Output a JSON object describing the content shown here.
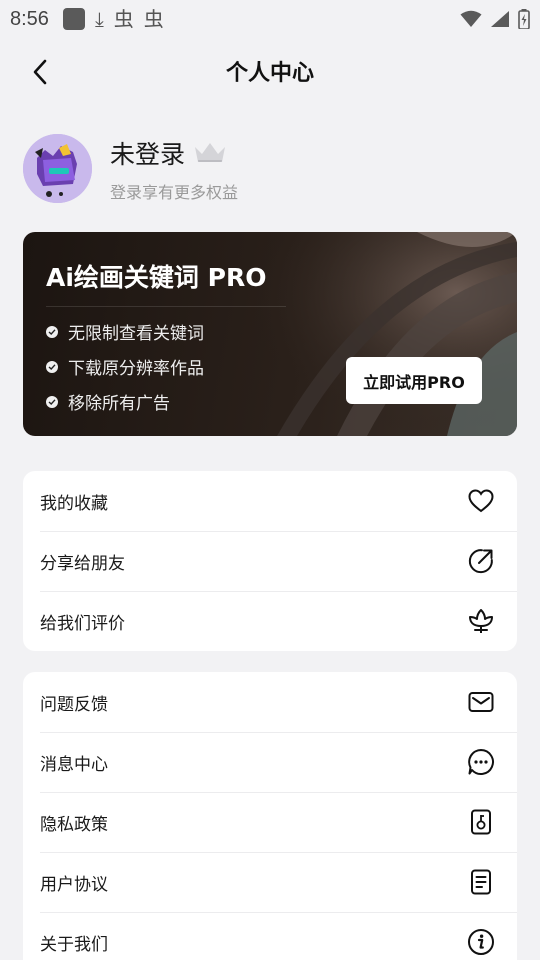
{
  "status_bar": {
    "time": "8:56",
    "notif_icons": [
      "app-square-icon",
      "download-icon",
      "bug-icon",
      "bug-icon"
    ],
    "notif_glyphs": [
      "⤓",
      "虫",
      "虫"
    ]
  },
  "header": {
    "title": "个人中心"
  },
  "profile": {
    "name": "未登录",
    "subtitle": "登录享有更多权益"
  },
  "pro_card": {
    "title": "Ai绘画关键词 PRO",
    "features": [
      "无限制查看关键词",
      "下载原分辨率作品",
      "移除所有广告"
    ],
    "cta_label": "立即试用PRO"
  },
  "menu_group_1": [
    {
      "label": "我的收藏",
      "icon": "heart-icon"
    },
    {
      "label": "分享给朋友",
      "icon": "share-icon"
    },
    {
      "label": "给我们评价",
      "icon": "flower-icon"
    }
  ],
  "menu_group_2": [
    {
      "label": "问题反馈",
      "icon": "mail-icon"
    },
    {
      "label": "消息中心",
      "icon": "chat-icon"
    },
    {
      "label": "隐私政策",
      "icon": "privacy-icon"
    },
    {
      "label": "用户协议",
      "icon": "document-icon"
    },
    {
      "label": "关于我们",
      "icon": "info-icon"
    }
  ],
  "colors": {
    "background": "#f2f2f4",
    "card": "#ffffff",
    "pro_card": "#1c1511",
    "text_primary": "#111111",
    "text_secondary": "#9a9a9a"
  }
}
